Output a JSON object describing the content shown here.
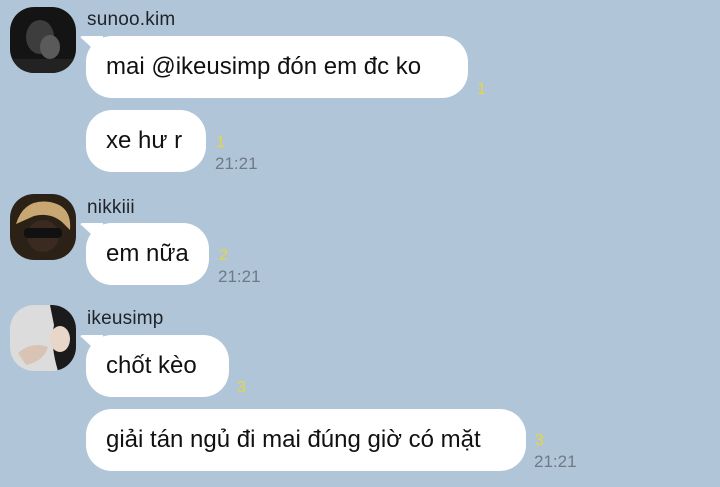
{
  "chat": {
    "messages": [
      {
        "sender": "sunoo.kim",
        "bubbles": [
          {
            "text": "mai @ikeusimp đón em đc ko",
            "unread": "1",
            "time": ""
          },
          {
            "text": "xe hư r",
            "unread": "1",
            "time": "21:21"
          }
        ]
      },
      {
        "sender": "nikkiii",
        "bubbles": [
          {
            "text": "em nữa",
            "unread": "2",
            "time": "21:21"
          }
        ]
      },
      {
        "sender": "ikeusimp",
        "bubbles": [
          {
            "text": "chốt kèo",
            "unread": "3",
            "time": ""
          },
          {
            "text": "giải tán ngủ đi mai đúng giờ có mặt",
            "unread": "3",
            "time": "21:21"
          }
        ]
      }
    ]
  },
  "colors": {
    "background": "#b1c5d9",
    "bubble": "#ffffff",
    "unread": "#ead53a",
    "time": "#6e7a86"
  }
}
